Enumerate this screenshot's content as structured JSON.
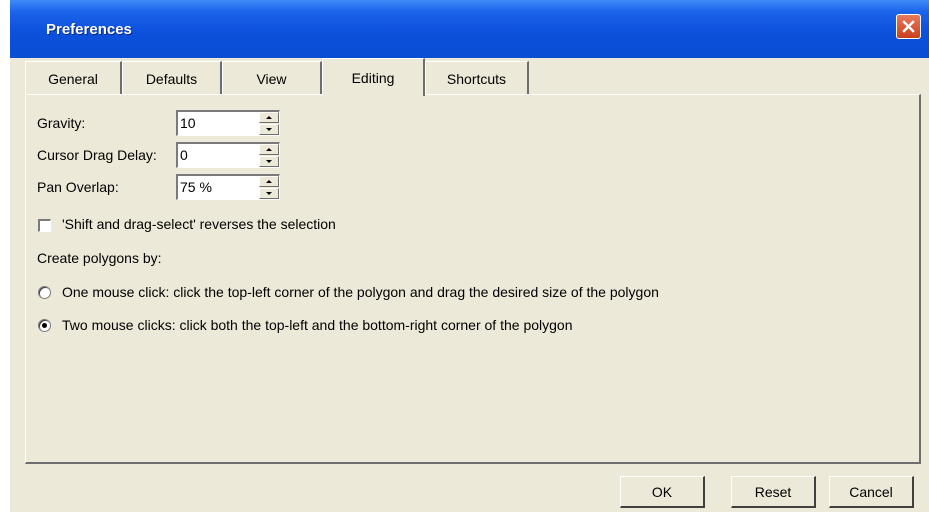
{
  "window": {
    "title": "Preferences"
  },
  "tabs": [
    {
      "label": "General",
      "active": false
    },
    {
      "label": "Defaults",
      "active": false
    },
    {
      "label": "View",
      "active": false
    },
    {
      "label": "Editing",
      "active": true
    },
    {
      "label": "Shortcuts",
      "active": false
    }
  ],
  "fields": {
    "gravity": {
      "label": "Gravity:",
      "value": "10"
    },
    "cursor_drag_delay": {
      "label": "Cursor Drag Delay:",
      "value": "0"
    },
    "pan_overlap": {
      "label": "Pan Overlap:",
      "value": "75 %"
    }
  },
  "shift_drag": {
    "label": "'Shift and drag-select' reverses the selection",
    "checked": false
  },
  "polygons": {
    "heading": "Create polygons by:",
    "options": [
      {
        "label": "One mouse click: click the top-left corner of the polygon and drag the desired size of the polygon",
        "selected": false
      },
      {
        "label": "Two mouse clicks: click both the top-left and the bottom-right corner of the polygon",
        "selected": true
      }
    ]
  },
  "buttons": {
    "ok": "OK",
    "reset": "Reset",
    "cancel": "Cancel"
  },
  "icons": {
    "close": "close-icon",
    "spin_up": "spin-up-icon",
    "spin_down": "spin-down-icon"
  }
}
